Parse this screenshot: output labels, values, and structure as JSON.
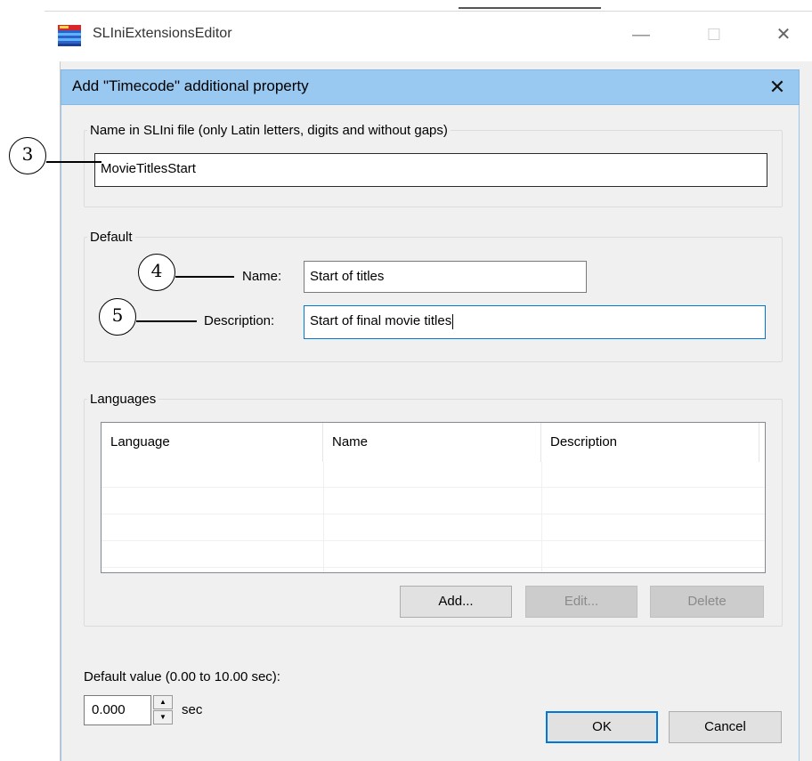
{
  "background_window": {
    "title": "SLIniExtensionsEditor",
    "minimize_glyph": "—",
    "maximize_glyph": "☐",
    "close_glyph": "✕",
    "icon": "app-window-icon"
  },
  "dialog": {
    "title": "Add \"Timecode\" additional property",
    "close_glyph": "✕",
    "name_group": {
      "legend": "Name in SLIni file (only Latin letters, digits and without gaps)",
      "value": "MovieTitlesStart"
    },
    "default_group": {
      "legend": "Default",
      "name_label": "Name:",
      "name_value": "Start of titles",
      "description_label": "Description:",
      "description_value": "Start of final movie titles"
    },
    "languages_group": {
      "legend": "Languages",
      "columns": [
        "Language",
        "Name",
        "Description"
      ],
      "rows": [],
      "add_label": "Add...",
      "edit_label": "Edit...",
      "delete_label": "Delete"
    },
    "default_value": {
      "label": "Default value (0.00 to 10.00 sec):",
      "value": "0.000",
      "unit": "sec"
    },
    "ok_label": "OK",
    "cancel_label": "Cancel"
  },
  "callouts": {
    "c3": "3",
    "c4": "4",
    "c5": "5"
  },
  "colors": {
    "dialog_title_bar": "#99c8f0",
    "focus_border": "#0078d7",
    "dialog_background": "#f0f0f0"
  }
}
